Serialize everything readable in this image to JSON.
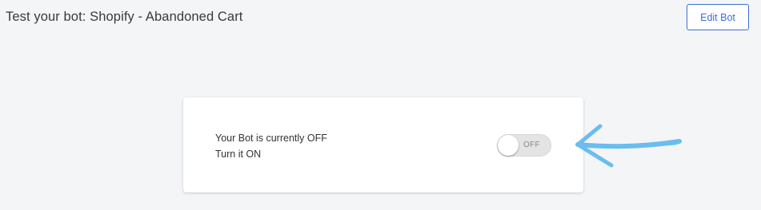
{
  "header": {
    "title": "Test your bot: Shopify - Abandoned Cart",
    "edit_button_label": "Edit Bot"
  },
  "card": {
    "status_line": "Your Bot is currently OFF",
    "action_line": "Turn it ON",
    "toggle": {
      "state_label": "OFF",
      "is_on": false
    }
  },
  "annotation": {
    "icon": "hand-drawn-arrow-icon",
    "color": "#5bb8f0"
  },
  "colors": {
    "accent": "#3d6fd6",
    "background": "#f4f5f7"
  }
}
